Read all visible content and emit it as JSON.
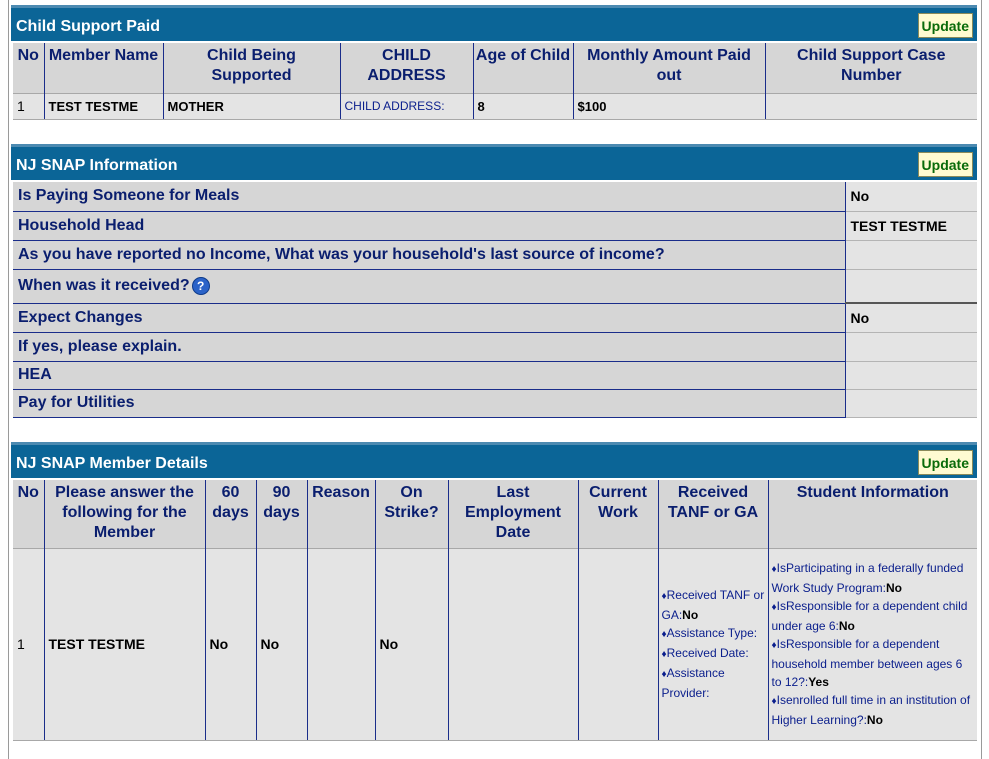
{
  "child_support": {
    "title": "Child Support Paid",
    "update_label": "Update",
    "columns": [
      "No",
      "Member Name",
      "Child Being Supported",
      "CHILD ADDRESS",
      "Age of Child",
      "Monthly Amount Paid out",
      "Child Support Case Number"
    ],
    "rows": [
      {
        "no": "1",
        "member_name": "TEST TESTME",
        "child": "MOTHER",
        "address": "CHILD ADDRESS:",
        "age": "8",
        "amount": "$100",
        "case_number": ""
      }
    ]
  },
  "snap_info": {
    "title": "NJ SNAP Information",
    "update_label": "Update",
    "rows": [
      {
        "label": "Is Paying Someone for Meals",
        "value": "No"
      },
      {
        "label": "Household Head",
        "value": "TEST TESTME"
      },
      {
        "label": "As you have reported no Income, What was your household's last source of income?",
        "value": ""
      },
      {
        "label": "When was it received?",
        "value": "",
        "help": "?"
      },
      {
        "label": "Expect Changes",
        "value": "No"
      },
      {
        "label": "If yes, please explain.",
        "value": ""
      },
      {
        "label": "HEA",
        "value": ""
      },
      {
        "label": "Pay for Utilities",
        "value": ""
      }
    ]
  },
  "member_details": {
    "title": "NJ SNAP Member Details",
    "update_label": "Update",
    "columns": [
      "No",
      "Please answer the following for the Member",
      "60 days",
      "90 days",
      "Reason",
      "On Strike?",
      "Last Employment Date",
      "Current Work",
      "Received TANF or GA",
      "Student Information"
    ],
    "row": {
      "no": "1",
      "member": "TEST TESTME",
      "d60": "No",
      "d90": "No",
      "reason": "",
      "on_strike": "No",
      "last_employment": "",
      "current_work": "",
      "tanf": [
        {
          "label": "Received TANF or GA:",
          "value": "No"
        },
        {
          "label": "Assistance Type:",
          "value": ""
        },
        {
          "label": "Received Date:",
          "value": ""
        },
        {
          "label": "Assistance Provider:",
          "value": ""
        }
      ],
      "student": [
        {
          "label": "IsParticipating in a federally funded Work Study Program:",
          "value": "No"
        },
        {
          "label": "IsResponsible for a dependent child under age 6:",
          "value": "No"
        },
        {
          "label": "IsResponsible for a dependent household member between ages 6 to 12?:",
          "value": "Yes"
        },
        {
          "label": "Isenrolled full time in an institution of Higher Learning?:",
          "value": "No"
        }
      ]
    }
  },
  "icons": {
    "bullet": "♦",
    "help": "help-icon"
  },
  "colors": {
    "header_bg": "#0b6597",
    "label_text": "#0a1e6e",
    "update_text": "#0a6b0a",
    "update_bg": "#fffbd1"
  }
}
